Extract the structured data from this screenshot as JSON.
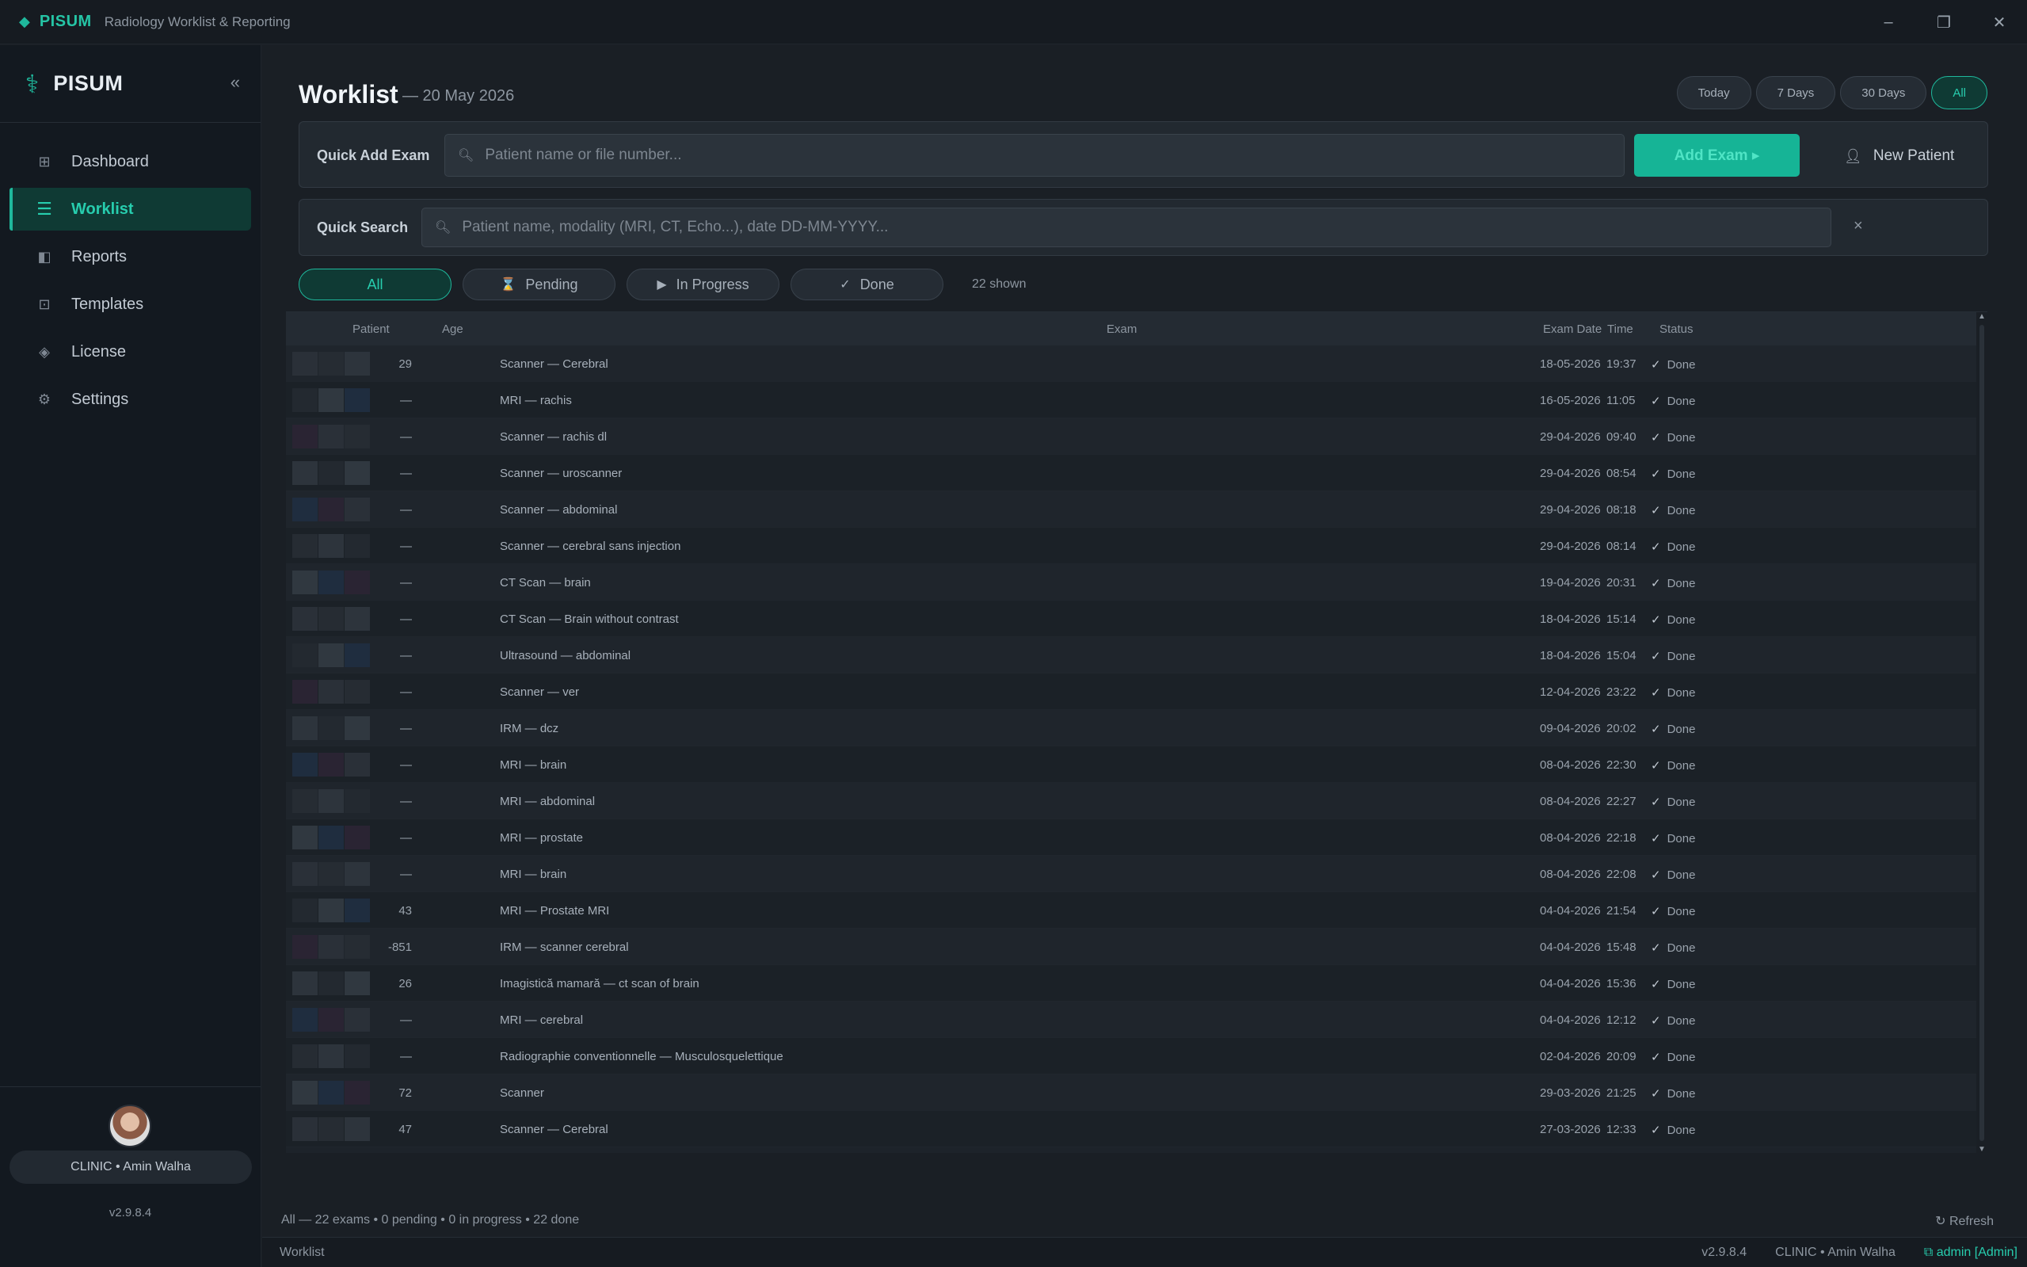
{
  "titlebar": {
    "brand": "PISUM",
    "subtitle": "Radiology Worklist & Reporting",
    "minimize": "–",
    "maximize": "❐",
    "close": "✕"
  },
  "sidebar": {
    "brand": "PISUM",
    "collapse": "«",
    "items": [
      {
        "label": "Dashboard",
        "icon": "grid-icon",
        "glyph": "⊞"
      },
      {
        "label": "Worklist",
        "icon": "list-icon",
        "glyph": "☰",
        "active": true
      },
      {
        "label": "Reports",
        "icon": "report-icon",
        "glyph": "◧"
      },
      {
        "label": "Templates",
        "icon": "template-icon",
        "glyph": "⊡"
      },
      {
        "label": "License",
        "icon": "license-icon",
        "glyph": "◈"
      },
      {
        "label": "Settings",
        "icon": "gear-icon",
        "glyph": "⚙"
      }
    ],
    "user": "CLINIC  •  Amin Walha",
    "version": "v2.9.8.4"
  },
  "header": {
    "title": "Worklist",
    "date": "— 20 May 2026"
  },
  "ranges": [
    "Today",
    "7 Days",
    "30 Days",
    "All"
  ],
  "quick_add": {
    "label": "Quick Add Exam",
    "placeholder": "Patient name or file number...",
    "add_button": "Add Exam ▸",
    "new_patient": "New Patient"
  },
  "quick_search": {
    "label": "Quick Search",
    "placeholder": "Patient name, modality (MRI, CT, Echo...), date DD-MM-YYYY...",
    "clear": "×"
  },
  "filters": [
    {
      "label": "All",
      "glyph": ""
    },
    {
      "label": "Pending",
      "glyph": "⌛"
    },
    {
      "label": "In Progress",
      "glyph": "▶"
    },
    {
      "label": "Done",
      "glyph": "✓"
    }
  ],
  "shown_count": "22 shown",
  "table": {
    "columns": {
      "patient": "Patient",
      "age": "Age",
      "exam": "Exam",
      "date": "Exam Date",
      "time": "Time",
      "status": "Status"
    },
    "rows": [
      {
        "age": "29",
        "exam": "Scanner — Cerebral",
        "date": "18-05-2026",
        "time": "19:37",
        "status": "Done"
      },
      {
        "age": "—",
        "exam": "MRI — rachis",
        "date": "16-05-2026",
        "time": "11:05",
        "status": "Done"
      },
      {
        "age": "—",
        "exam": "Scanner — rachis dl",
        "date": "29-04-2026",
        "time": "09:40",
        "status": "Done"
      },
      {
        "age": "—",
        "exam": "Scanner — uroscanner",
        "date": "29-04-2026",
        "time": "08:54",
        "status": "Done"
      },
      {
        "age": "—",
        "exam": "Scanner — abdominal",
        "date": "29-04-2026",
        "time": "08:18",
        "status": "Done"
      },
      {
        "age": "—",
        "exam": "Scanner — cerebral sans injection",
        "date": "29-04-2026",
        "time": "08:14",
        "status": "Done"
      },
      {
        "age": "—",
        "exam": "CT Scan — brain",
        "date": "19-04-2026",
        "time": "20:31",
        "status": "Done"
      },
      {
        "age": "—",
        "exam": "CT Scan — Brain without contrast",
        "date": "18-04-2026",
        "time": "15:14",
        "status": "Done"
      },
      {
        "age": "—",
        "exam": "Ultrasound — abdominal",
        "date": "18-04-2026",
        "time": "15:04",
        "status": "Done"
      },
      {
        "age": "—",
        "exam": "Scanner — ver",
        "date": "12-04-2026",
        "time": "23:22",
        "status": "Done"
      },
      {
        "age": "—",
        "exam": "IRM — dcz",
        "date": "09-04-2026",
        "time": "20:02",
        "status": "Done"
      },
      {
        "age": "—",
        "exam": "MRI — brain",
        "date": "08-04-2026",
        "time": "22:30",
        "status": "Done"
      },
      {
        "age": "—",
        "exam": "MRI — abdominal",
        "date": "08-04-2026",
        "time": "22:27",
        "status": "Done"
      },
      {
        "age": "—",
        "exam": "MRI — prostate",
        "date": "08-04-2026",
        "time": "22:18",
        "status": "Done"
      },
      {
        "age": "—",
        "exam": "MRI — brain",
        "date": "08-04-2026",
        "time": "22:08",
        "status": "Done"
      },
      {
        "age": "43",
        "exam": "MRI — Prostate MRI",
        "date": "04-04-2026",
        "time": "21:54",
        "status": "Done"
      },
      {
        "age": "-851",
        "exam": "IRM — scanner cerebral",
        "date": "04-04-2026",
        "time": "15:48",
        "status": "Done"
      },
      {
        "age": "26",
        "exam": "Imagistică mamară — ct scan of brain",
        "date": "04-04-2026",
        "time": "15:36",
        "status": "Done"
      },
      {
        "age": "—",
        "exam": "MRI — cerebral",
        "date": "04-04-2026",
        "time": "12:12",
        "status": "Done"
      },
      {
        "age": "—",
        "exam": "Radiographie conventionnelle — Musculosquelettique",
        "date": "02-04-2026",
        "time": "20:09",
        "status": "Done"
      },
      {
        "age": "72",
        "exam": "Scanner",
        "date": "29-03-2026",
        "time": "21:25",
        "status": "Done"
      },
      {
        "age": "47",
        "exam": "Scanner — Cerebral",
        "date": "27-03-2026",
        "time": "12:33",
        "status": "Done"
      }
    ]
  },
  "summary": {
    "text": "All  —  22 exams  •  0 pending  •  0 in progress  •  22 done",
    "refresh": "↻  Refresh"
  },
  "statusbar": {
    "left": "Worklist",
    "version": "v2.9.8.4",
    "user": "CLINIC  •  Amin Walha",
    "admin": "admin  [Admin]"
  },
  "colors": {
    "accent": "#1fb89c",
    "background": "#1a1f25",
    "sidebar": "#131920"
  }
}
